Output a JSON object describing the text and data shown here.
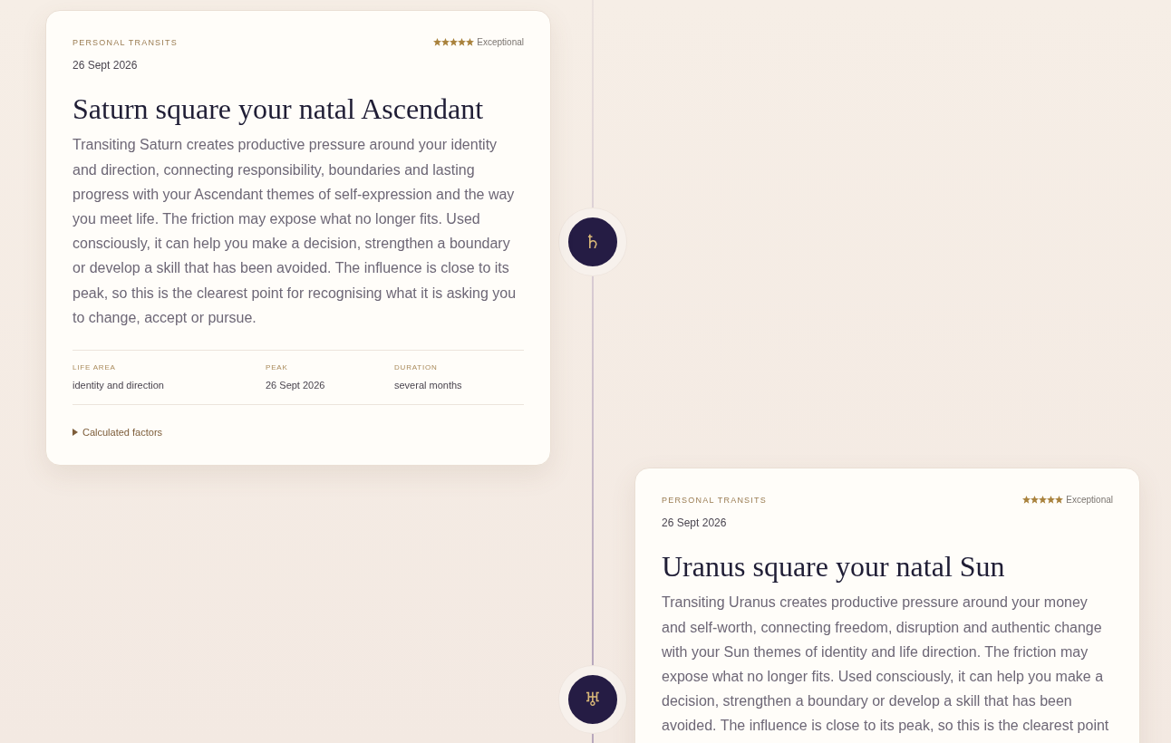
{
  "entries": [
    {
      "glyph": "♄",
      "category": "PERSONAL TRANSITS",
      "stars": 5,
      "rating": "Exceptional",
      "date": "26 Sept 2026",
      "title": "Saturn square your natal Ascendant",
      "body": "Transiting Saturn creates productive pressure around your identity and direction, connecting responsibility, boundaries and lasting progress with your Ascendant themes of self-expression and the way you meet life. The friction may expose what no longer fits. Used consciously, it can help you make a decision, strengthen a boundary or develop a skill that has been avoided. The influence is close to its peak, so this is the clearest point for recognising what it is asking you to change, accept or pursue.",
      "meta": [
        {
          "label": "LIFE AREA",
          "value": "identity and direction"
        },
        {
          "label": "PEAK",
          "value": "26 Sept 2026"
        },
        {
          "label": "DURATION",
          "value": "several months"
        }
      ],
      "details": {
        "label": "Calculated factors",
        "expanded": false
      }
    },
    {
      "glyph": "♅",
      "category": "PERSONAL TRANSITS",
      "stars": 5,
      "rating": "Exceptional",
      "date": "26 Sept 2026",
      "title": "Uranus square your natal Sun",
      "body": "Transiting Uranus creates productive pressure around your money and self-worth, connecting freedom, disruption and authentic change with your Sun themes of identity and life direction. The friction may expose what no longer fits. Used consciously, it can help you make a decision, strengthen a boundary or develop a skill that has been avoided. The influence is close to its peak, so this is the clearest point"
    }
  ]
}
